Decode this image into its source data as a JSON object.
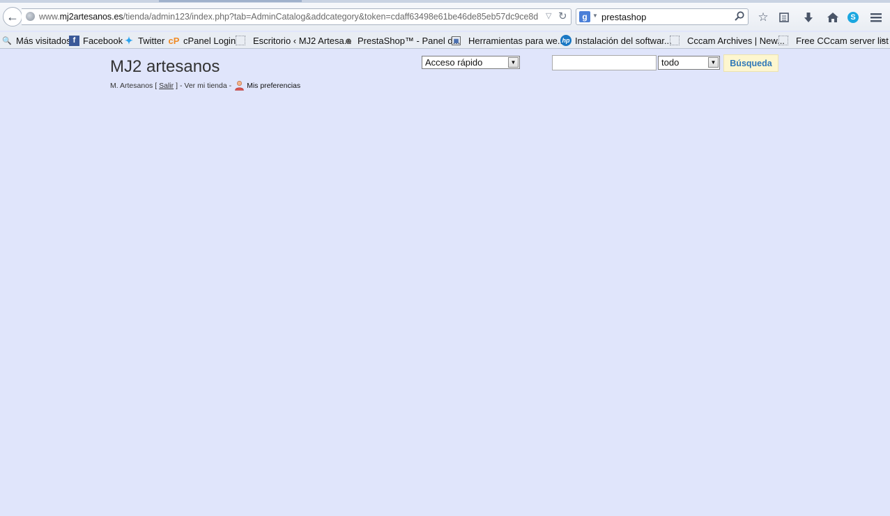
{
  "browser": {
    "url_prefix": "www.",
    "url_host": "mj2artesanos.es",
    "url_path": "/tienda/admin123/index.php?tab=AdminCatalog&addcategory&token=cdaff63498e61be46de85eb57dc9ce8d",
    "search_query": "prestashop",
    "search_engine_icon": "google-icon",
    "bookmarks": [
      {
        "label": "Más visitados",
        "icon": "most-visited-icon"
      },
      {
        "label": "Facebook",
        "icon": "facebook-icon"
      },
      {
        "label": "Twitter",
        "icon": "twitter-icon"
      },
      {
        "label": "cPanel Login",
        "icon": "cpanel-icon"
      },
      {
        "label": "Escritorio ‹ MJ2 Artesa...",
        "icon": "page-icon"
      },
      {
        "label": "PrestaShop™ - Panel d...",
        "icon": "prestashop-icon"
      },
      {
        "label": "Herramientas para we...",
        "icon": "tools-icon"
      },
      {
        "label": "Instalación del softwar...",
        "icon": "hp-icon"
      },
      {
        "label": "Cccam Archives | New...",
        "icon": "page-icon"
      },
      {
        "label": "Free CCcam server list",
        "icon": "page-icon"
      }
    ],
    "overflow_label": "»"
  },
  "page": {
    "site_title": "MJ2 artesanos",
    "user_name": "M. Artesanos [",
    "logout_label": "Salir",
    "after_logout": "] - Ver mi tienda -",
    "preferences_label": "Mis preferencias",
    "quick_access_label": "Acceso rápido",
    "search_scope": "todo",
    "search_value": "",
    "search_button_label": "Búsqueda"
  },
  "colors": {
    "page_background": "#e0e5fb",
    "search_button_bg": "#fdf6cf",
    "search_button_text": "#2f78b8"
  }
}
